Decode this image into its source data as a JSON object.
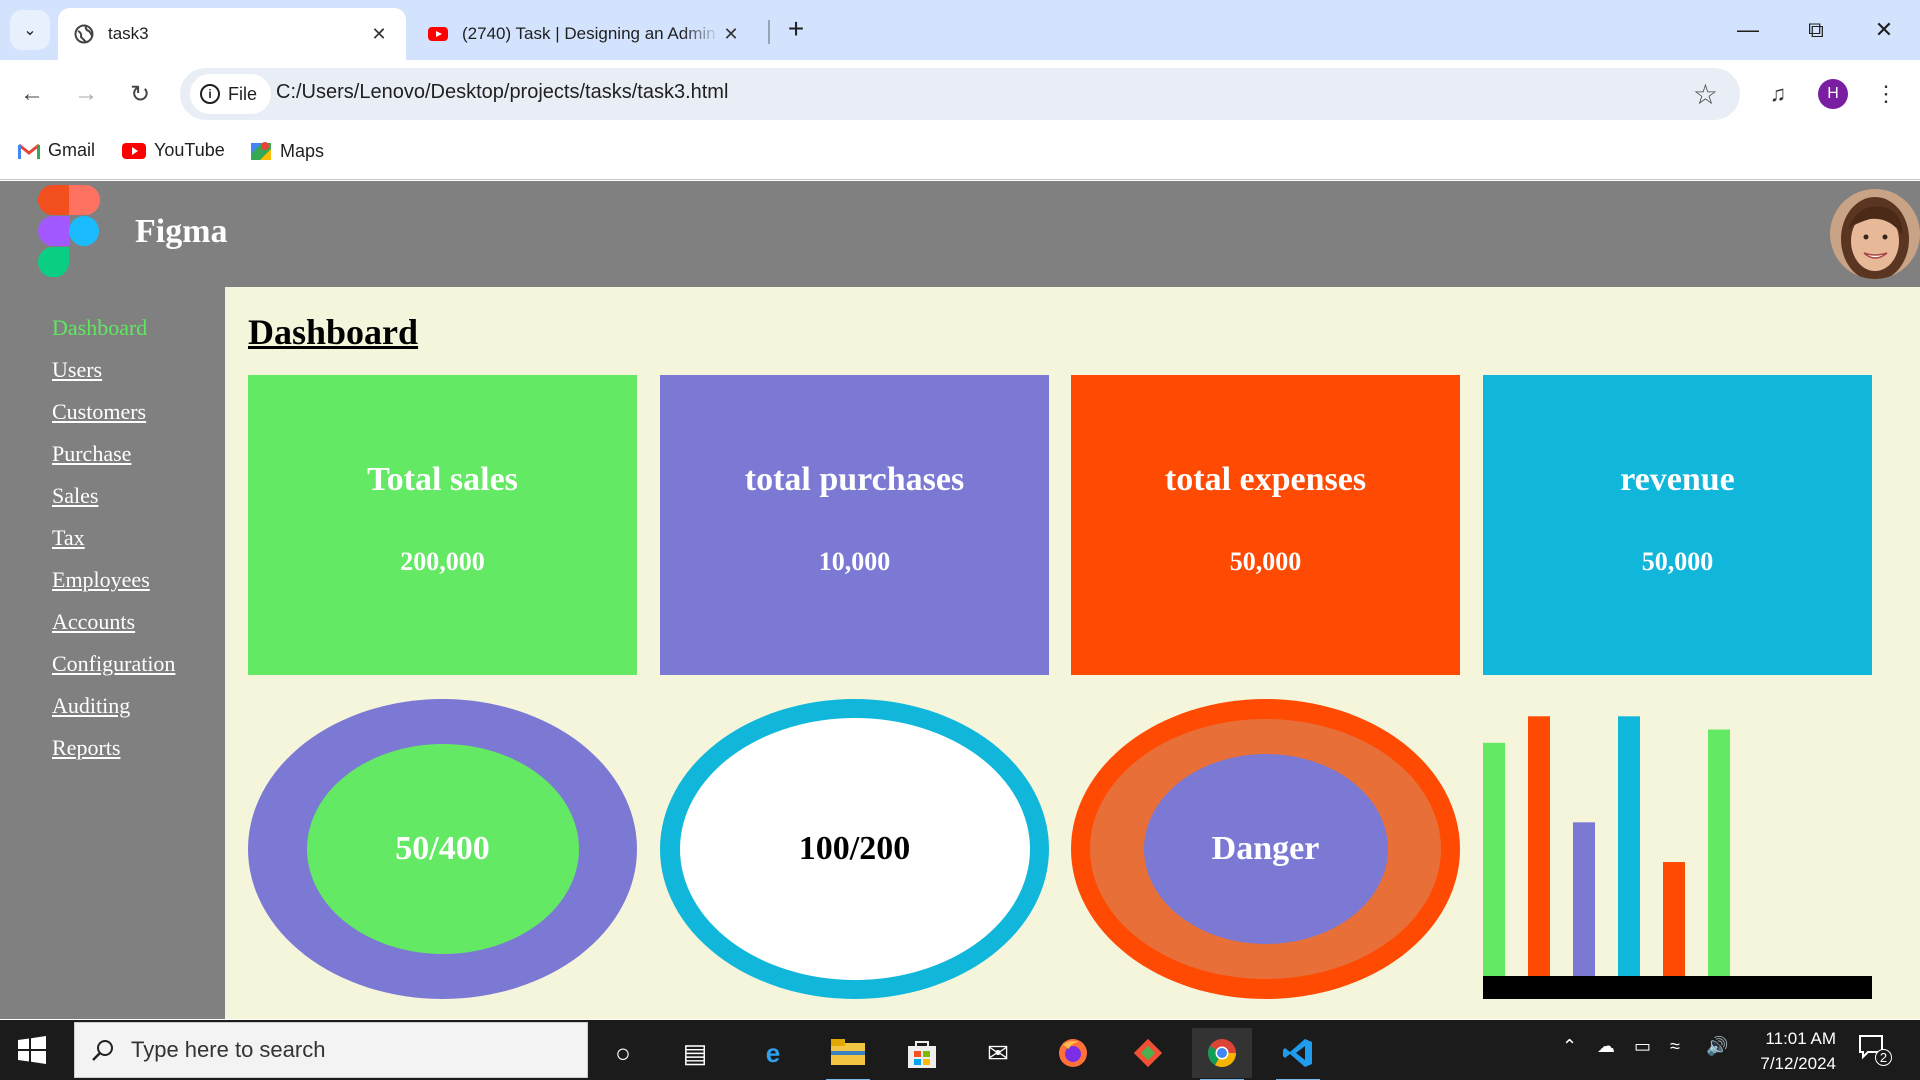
{
  "browser": {
    "tabs": [
      {
        "title": "task3",
        "active": true
      },
      {
        "title": "(2740) Task | Designing an Admin Dashboard",
        "active": false
      }
    ],
    "address": {
      "chip": "File",
      "url": "C:/Users/Lenovo/Desktop/projects/tasks/task3.html"
    },
    "profile_initial": "H",
    "bookmarks": [
      "Gmail",
      "YouTube",
      "Maps"
    ]
  },
  "page": {
    "brand": "Figma",
    "nav": [
      {
        "label": "Dashboard",
        "active": true
      },
      {
        "label": "Users"
      },
      {
        "label": "Customers"
      },
      {
        "label": "Purchase"
      },
      {
        "label": "Sales"
      },
      {
        "label": "Tax"
      },
      {
        "label": "Employees"
      },
      {
        "label": "Accounts"
      },
      {
        "label": "Configuration"
      },
      {
        "label": "Auditing"
      },
      {
        "label": "Reports"
      }
    ],
    "heading": "Dashboard",
    "cards": [
      {
        "title": "Total sales",
        "value": "200,000",
        "color": "#63e963"
      },
      {
        "title": "total purchases",
        "value": "10,000",
        "color": "#7b79d3"
      },
      {
        "title": "total expenses",
        "value": "50,000",
        "color": "#fe4a02"
      },
      {
        "title": "revenue",
        "value": "50,000",
        "color": "#10b7da"
      }
    ],
    "rings": [
      {
        "label": "50/400",
        "outer": "#7b79d3",
        "inner": "#63e963",
        "text_color": "#ffffff"
      },
      {
        "label": "100/200",
        "outer": "#10b7da",
        "inner": "#ffffff",
        "text_color": "#000000"
      },
      {
        "label": "Danger",
        "outer": "#fe4a02",
        "mid": "#e86f38",
        "inner": "#7b79d3",
        "text_color": "#ffffff"
      }
    ],
    "mini_chart_colors": [
      "#63e963",
      "#fe4a02",
      "#7b79d3",
      "#10b7da",
      "#fe4a02",
      "#63e963"
    ]
  },
  "chart_data": {
    "type": "bar",
    "categories": [
      "",
      "",
      "",
      "",
      "",
      ""
    ],
    "values": [
      88,
      98,
      58,
      98,
      43,
      93
    ],
    "ylim": [
      0,
      100
    ]
  },
  "taskbar": {
    "search_placeholder": "Type here to search",
    "time": "11:01 AM",
    "date": "7/12/2024",
    "notifications": "2"
  }
}
